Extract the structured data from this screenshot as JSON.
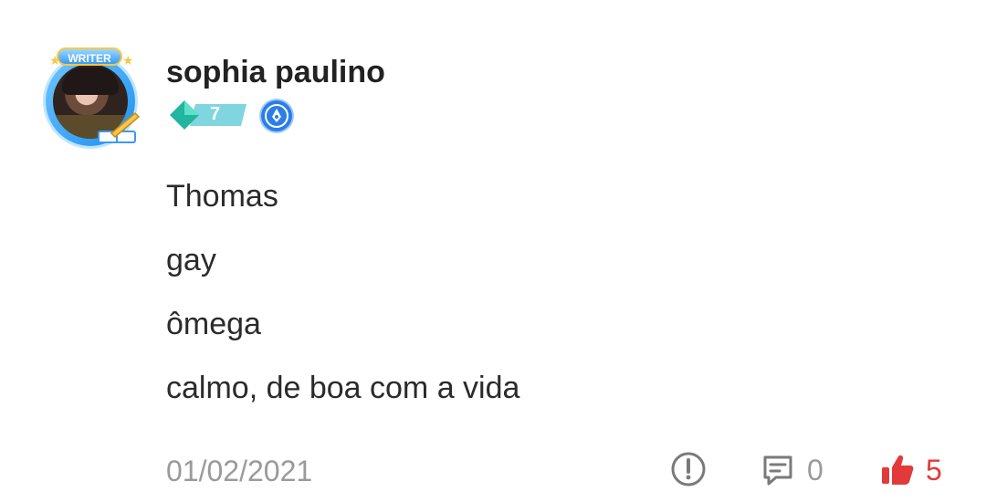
{
  "author": {
    "name": "sophia paulino",
    "frame_label": "WRITER",
    "level": "7"
  },
  "post": {
    "lines": [
      "Thomas",
      "gay",
      "ômega",
      "calmo, de boa com a vida"
    ],
    "date": "01/02/2021"
  },
  "actions": {
    "comment_count": "0",
    "like_count": "5"
  },
  "colors": {
    "like": "#e23a3a",
    "muted": "#9a9a9a",
    "level_badge": "#3fc7b7",
    "title_badge": "#2b7ee6"
  },
  "icons": [
    "writer-frame",
    "level-diamond-icon",
    "pen-nib-icon",
    "report-icon",
    "comment-icon",
    "thumbs-up-icon"
  ]
}
